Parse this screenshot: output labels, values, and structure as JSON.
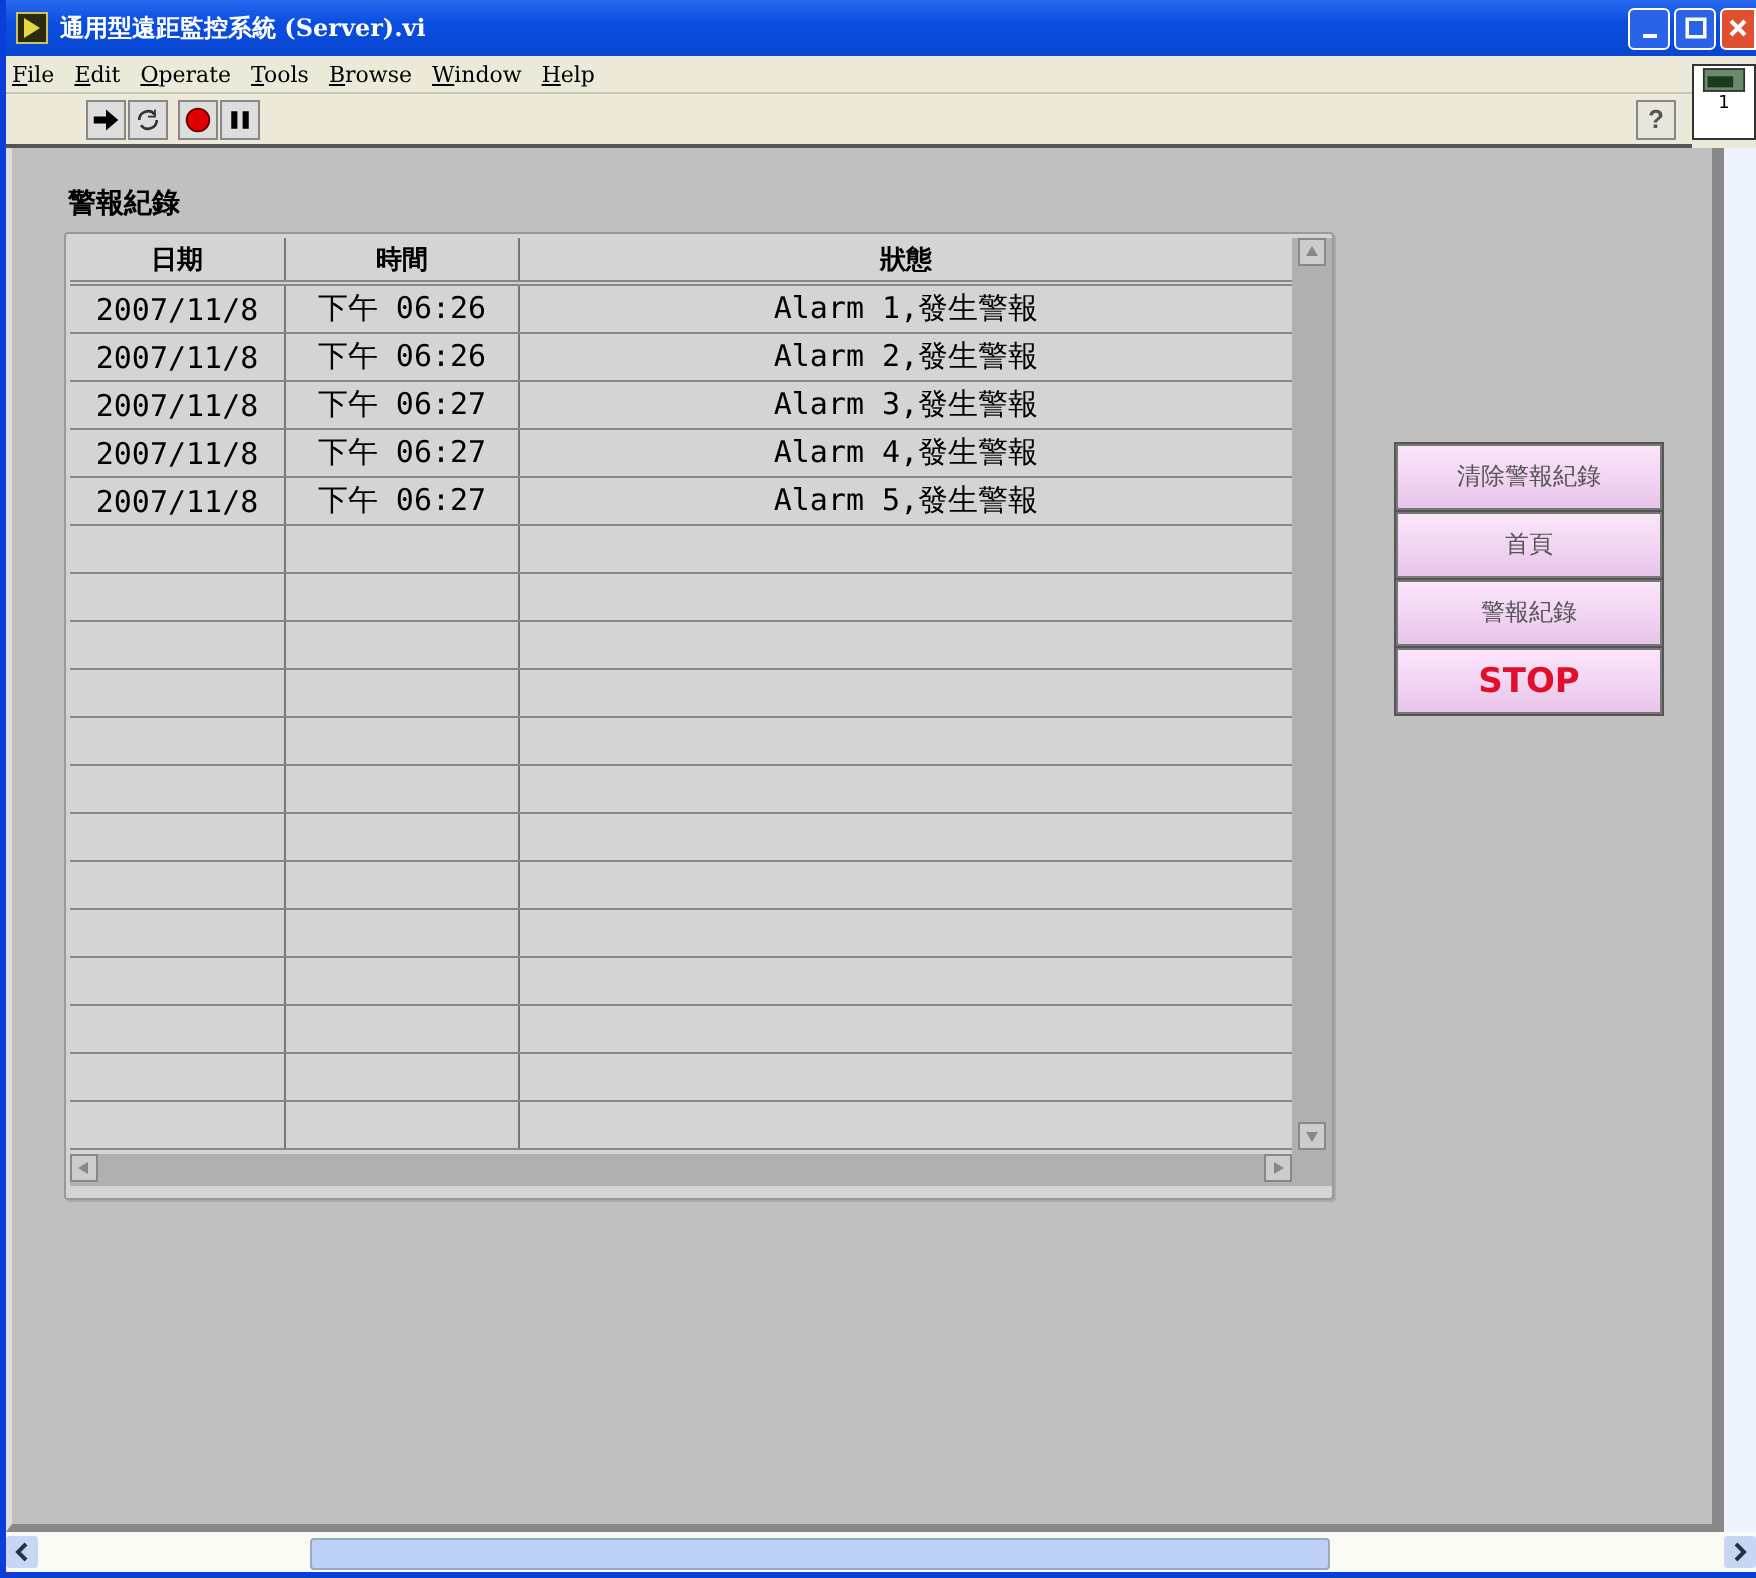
{
  "window": {
    "title": "通用型遠距監控系統 (Server).vi"
  },
  "menu": [
    "File",
    "Edit",
    "Operate",
    "Tools",
    "Browse",
    "Window",
    "Help"
  ],
  "toolbar": {
    "help_button": "?",
    "vi_icon_label": "1"
  },
  "log": {
    "title": "警報紀錄",
    "columns": [
      "日期",
      "時間",
      "狀態"
    ],
    "rows": [
      {
        "date": "2007/11/8",
        "time": "下午 06:26",
        "status": "Alarm 1,發生警報"
      },
      {
        "date": "2007/11/8",
        "time": "下午 06:26",
        "status": "Alarm 2,發生警報"
      },
      {
        "date": "2007/11/8",
        "time": "下午 06:27",
        "status": "Alarm 3,發生警報"
      },
      {
        "date": "2007/11/8",
        "time": "下午 06:27",
        "status": "Alarm 4,發生警報"
      },
      {
        "date": "2007/11/8",
        "time": "下午 06:27",
        "status": "Alarm 5,發生警報"
      }
    ]
  },
  "buttons": [
    {
      "label": "清除警報紀錄",
      "kind": "nav"
    },
    {
      "label": "首頁",
      "kind": "nav"
    },
    {
      "label": "警報紀錄",
      "kind": "nav"
    },
    {
      "label": "STOP",
      "kind": "stop"
    }
  ]
}
